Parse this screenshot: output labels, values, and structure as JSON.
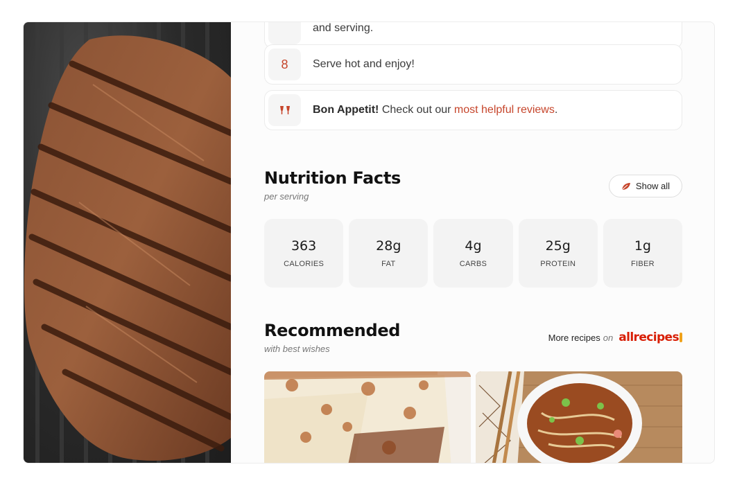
{
  "steps": [
    {
      "number": "",
      "text": "and serving."
    },
    {
      "number": "8",
      "text": "Serve hot and enjoy!"
    }
  ],
  "bon_appetit": {
    "icon": "cheers-icon",
    "bold": "Bon Appetit!",
    "text": "Check out our",
    "link": "most helpful reviews",
    "end": "."
  },
  "nutrition": {
    "title": "Nutrition Facts",
    "subtitle": "per serving",
    "show_all_label": "Show all",
    "show_all_icon": "leaf-icon",
    "items": [
      {
        "value": "363",
        "label": "CALORIES"
      },
      {
        "value": "28g",
        "label": "FAT"
      },
      {
        "value": "4g",
        "label": "CARBS"
      },
      {
        "value": "25g",
        "label": "PROTEIN"
      },
      {
        "value": "1g",
        "label": "FIBER"
      }
    ]
  },
  "recommended": {
    "title": "Recommended",
    "subtitle": "with best wishes",
    "more_label": "More recipes",
    "more_on": "on",
    "brand": "allrecipes",
    "cards": [
      {
        "image": "lasagna-photo"
      },
      {
        "image": "noodle-soup-photo"
      }
    ]
  },
  "hero_image": "grilled-steak-photo",
  "colors": {
    "accent": "#c6452b",
    "brand": "#d81e05"
  }
}
